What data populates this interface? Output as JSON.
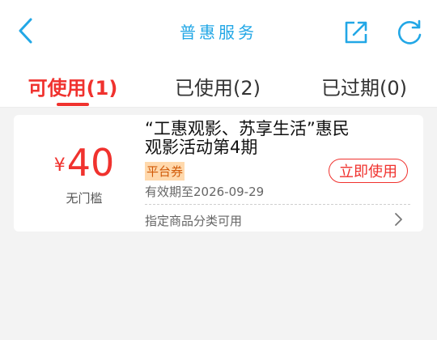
{
  "header": {
    "title": "普惠服务",
    "back_icon": "chevron-left-icon",
    "share_icon": "share-icon",
    "refresh_icon": "refresh-icon",
    "accent": "#22a7e6"
  },
  "tabs": [
    {
      "label": "可使用(1)",
      "active": true
    },
    {
      "label": "已使用(2)",
      "active": false
    },
    {
      "label": "已过期(0)",
      "active": false
    }
  ],
  "coupon": {
    "currency": "¥",
    "amount": "40",
    "threshold": "无门槛",
    "title_line1": "“工惠观影、苏享生活”惠民",
    "title_line2": "观影活动第4期",
    "tag": "平台券",
    "action": "立即使用",
    "validity": "有效期至2026-09-29",
    "scope": "指定商品分类可用",
    "accent": "#f0322e"
  }
}
